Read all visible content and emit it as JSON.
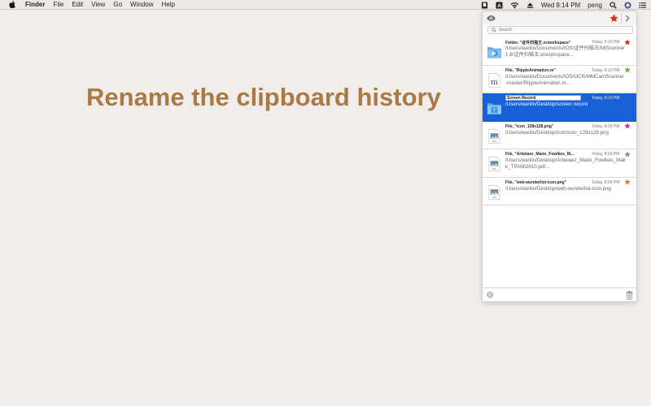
{
  "menubar": {
    "app_name": "Finder",
    "menus": [
      "File",
      "Edit",
      "View",
      "Go",
      "Window",
      "Help"
    ],
    "clock": "Wed 8:14 PM",
    "user": "peng",
    "input_source": "A"
  },
  "headline": "Rename the clipboard history",
  "popover": {
    "search_placeholder": "Search",
    "items": [
      {
        "title": "Folder, \"证件扫描王.xcworkspace\"",
        "time": "Today, 8:10 PM",
        "path": "/Users/wanlin/Documents/IOS/证件扫描王/MIScanner 1.6/证件扫描王.xcworkspace...",
        "icon": "folder-icon",
        "star_color": "#d8301c"
      },
      {
        "title": "File, \"RippleAnimation.m\"",
        "time": "Today, 8:10 PM",
        "path": "/Users/wanlin/Documents/IOS/OCR/MMCamScanner-master/RippleAnimation.m...",
        "icon": "objc-file-icon",
        "star_color": "#62b442"
      },
      {
        "title": "Screen Record",
        "time": "Today, 8:10 PM",
        "path": "/Users/wanlin/Desktop/screen record",
        "icon": "finder-icon",
        "star_color": "#1760d6"
      },
      {
        "title": "File, \"icon_128x128.png\"",
        "time": "Today, 8:09 PM",
        "path": "/Users/wanlin/Desktop/icon/icon_128x128.png",
        "icon": "png-file-icon",
        "star_color": "#c43aa6"
      },
      {
        "title": "File, \"Arbelaez_Maire_Fowlkes_M...",
        "time": "Today, 8:09 PM",
        "path": "/Users/wanlin/Desktop/Arbelaez_Maire_Fowlkes_Malik_TPAMI2010.pdf...",
        "icon": "pdf-file-icon",
        "star_color": "#8e8e8e"
      },
      {
        "title": "File, \"web-wunderlist-icon.png\"",
        "time": "Today, 8:09 PM",
        "path": "/Users/wanlin/Desktop/web-wunderlist-icon.png",
        "icon": "png-file-icon",
        "star_color": "#e07e2c"
      }
    ],
    "selected_index": 2,
    "favorites_star_color": "#d8301c"
  }
}
